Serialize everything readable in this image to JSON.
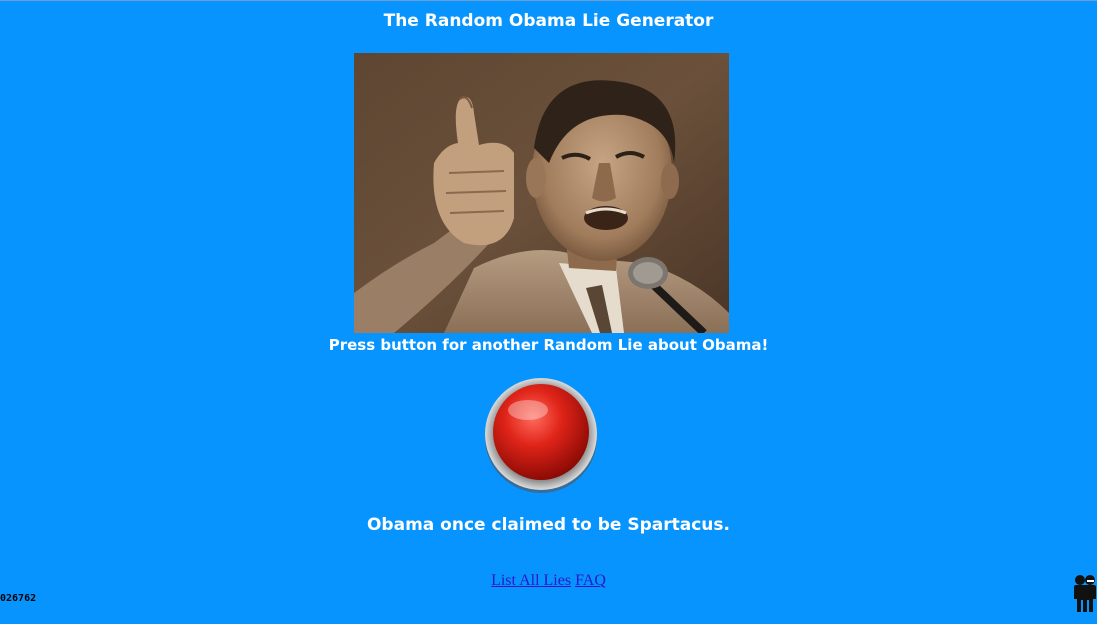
{
  "page": {
    "title": "The Random Obama Lie Generator",
    "prompt": "Press button for another Random Lie about Obama!",
    "lie": "Obama once claimed to be Spartacus."
  },
  "links": {
    "list_all": "List All Lies",
    "faq": "FAQ"
  },
  "counter": "026762",
  "icons": {
    "button": "red-button-icon",
    "corner": "people-icon"
  },
  "colors": {
    "background": "#0894ff",
    "text": "#ffffff",
    "link": "#2a16c9",
    "button_red": "#d81e14"
  }
}
